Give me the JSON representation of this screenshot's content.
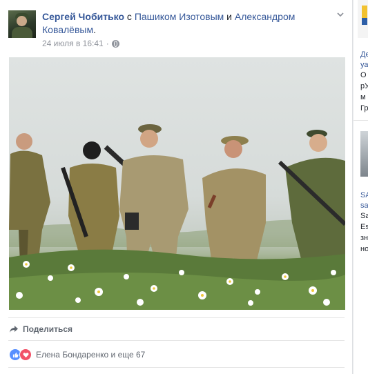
{
  "post": {
    "author": "Сергей Чобитько",
    "with_prefix": " с ",
    "tagged_1": "Пашиком Изотовым",
    "and_word": " и ",
    "tagged_2": "Александром Ковалёвым",
    "period": ".",
    "timestamp": "24 июля в 16:41",
    "separator": "·",
    "share_label": "Поделиться",
    "reactions_text": "Елена Бондаренко и еще 67",
    "icons": {
      "globe": "globe-icon",
      "share": "share-arrow-icon",
      "options": "chevron-down-icon",
      "like": "like-reaction-icon",
      "love": "love-reaction-icon"
    },
    "colors": {
      "link": "#365899",
      "like": "#5890ff",
      "love": "#f25268"
    }
  },
  "sidebar": {
    "items": [
      {
        "text": "Де",
        "style": "blue"
      },
      {
        "text": "уа",
        "style": "blue"
      },
      {
        "text": "О",
        "style": "dark"
      },
      {
        "text": "рУ",
        "style": "dark"
      },
      {
        "text": "м",
        "style": "dark"
      },
      {
        "text": "Гр",
        "style": "dark"
      },
      {
        "text": "SA",
        "style": "blue"
      },
      {
        "text": "sa",
        "style": "blue"
      },
      {
        "text": "Sa",
        "style": "dark"
      },
      {
        "text": "Es",
        "style": "dark"
      },
      {
        "text": "зн",
        "style": "dark"
      },
      {
        "text": "но",
        "style": "dark"
      }
    ]
  }
}
